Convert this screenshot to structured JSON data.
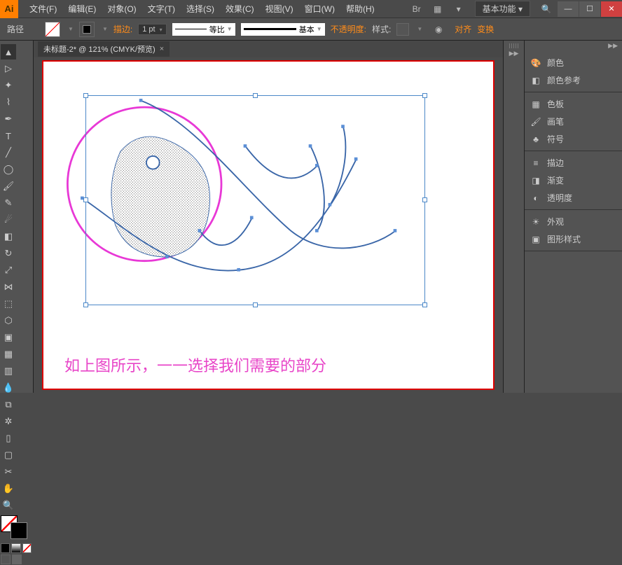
{
  "app": {
    "logo": "Ai"
  },
  "menu": {
    "items": [
      "文件(F)",
      "编辑(E)",
      "对象(O)",
      "文字(T)",
      "选择(S)",
      "效果(C)",
      "视图(V)",
      "窗口(W)",
      "帮助(H)"
    ]
  },
  "workspace": {
    "label": "基本功能",
    "arrow": "▾"
  },
  "win": {
    "min": "—",
    "max": "☐",
    "close": "✕"
  },
  "optbar": {
    "selection": "路径",
    "stroke_label": "描边:",
    "stroke_value": "1 pt",
    "profile_label": "等比",
    "brush_label": "基本",
    "opacity_label": "不透明度:",
    "style_label": "样式:",
    "align_label": "对齐",
    "transform_label": "变换"
  },
  "doc": {
    "tab_title": "未标题-2* @ 121% (CMYK/预览)",
    "tab_close": "×"
  },
  "caption": "如上图所示，一一选择我们需要的部分",
  "panels": {
    "color": "颜色",
    "color_guide": "颜色参考",
    "swatches": "色板",
    "brushes": "画笔",
    "symbols": "符号",
    "stroke": "描边",
    "gradient": "渐变",
    "transparency": "透明度",
    "appearance": "外观",
    "graphic_styles": "图形样式"
  }
}
